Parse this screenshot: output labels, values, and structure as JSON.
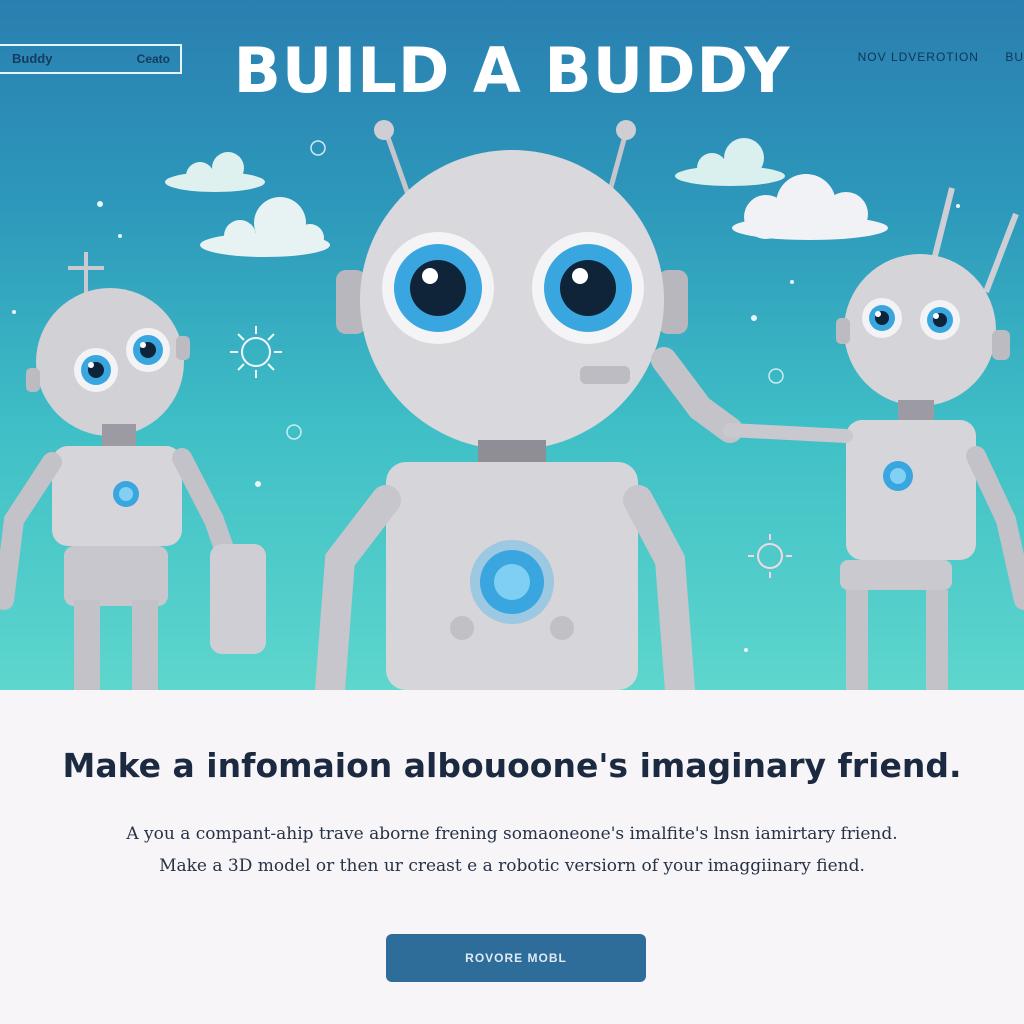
{
  "nav": {
    "logo": "Buddy",
    "left_link": "Ceato",
    "right_links": [
      "NOV LDVEROTION",
      "BU"
    ]
  },
  "hero": {
    "title": "BUILD A BUDDY"
  },
  "content": {
    "headline": "Make a infomaion albouoone's imaginary friend.",
    "line1": "A you a compant-ahip trave aborne frening somaoneone's imalfite's lnsn  iamirtary friend.",
    "line2": "Make a 3D model or then ur creast e a robotic versiorn of your imaggiinary fiend.",
    "cta_label": "ROVORE MOBL"
  },
  "colors": {
    "sky_top": "#2a7fb0",
    "sky_bottom": "#5ed6cd",
    "robot_body": "#d9d8dc",
    "eye_blue": "#3aa6e0",
    "cta": "#2e6d99",
    "headline": "#1b2a40"
  }
}
